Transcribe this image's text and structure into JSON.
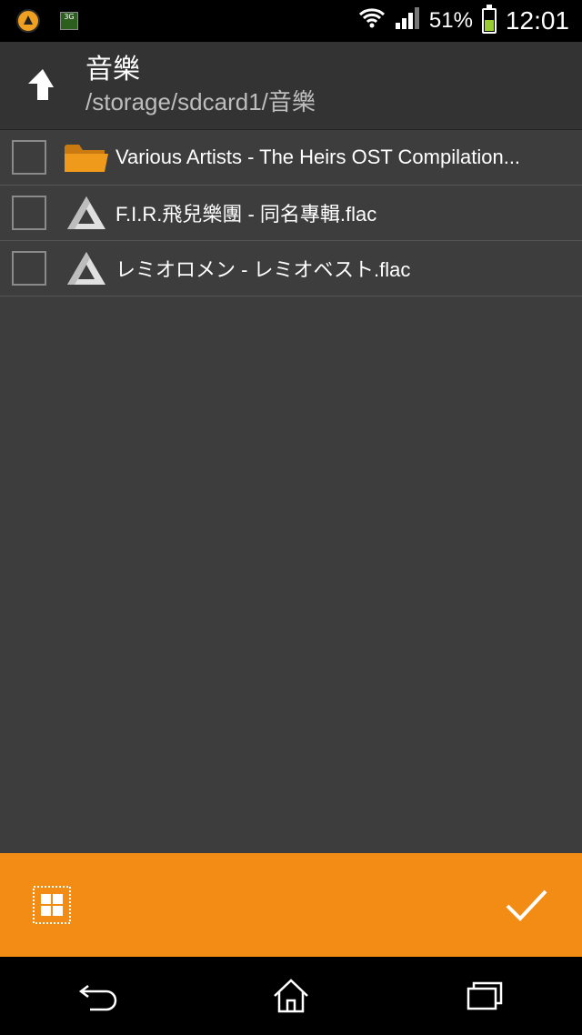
{
  "status": {
    "battery": "51%",
    "time": "12:01",
    "network_label": "3G"
  },
  "header": {
    "title": "音樂",
    "path": "/storage/sdcard1/音樂"
  },
  "files": [
    {
      "name": "Various Artists - The Heirs OST Compilation...",
      "type": "folder"
    },
    {
      "name": "F.I.R.飛兒樂團 - 同名專輯.flac",
      "type": "audio"
    },
    {
      "name": "レミオロメン - レミオベスト.flac",
      "type": "audio"
    }
  ],
  "colors": {
    "accent": "#f28c14",
    "background": "#3d3d3d",
    "header": "#333333"
  },
  "icons": {
    "up": "arrow-up-icon",
    "folder": "folder-icon",
    "audio": "aimp-triangle-icon",
    "select_all": "select-all-icon",
    "confirm": "checkmark-icon",
    "back": "back-icon",
    "home": "home-icon",
    "recents": "recents-icon"
  }
}
